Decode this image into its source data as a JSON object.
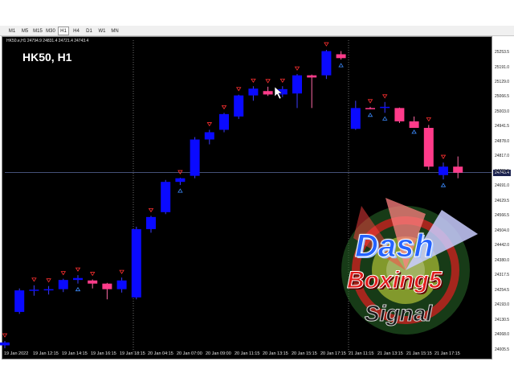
{
  "timeframes": [
    "M1",
    "M5",
    "M15",
    "M30",
    "H1",
    "H4",
    "D1",
    "W1",
    "MN"
  ],
  "active_timeframe": "H1",
  "chart": {
    "symbol_line": "HK50.e,H1  24794.9 24831.4 24721.4 24743.4",
    "title": "HK50, H1",
    "current_price_tag": "24743.4",
    "colors": {
      "bull": "#0a0aff",
      "bear": "#ff3b8a",
      "background": "#000000",
      "signal_up": "#20c020",
      "signal_down": "#ff3030",
      "wick": "#ffffff"
    }
  },
  "logo": {
    "line1": "Dash",
    "line2": "Boxing5",
    "line3": "Signal"
  },
  "chart_data": {
    "type": "candlestick",
    "y_ticks": [
      "25253.5",
      "25191.0",
      "25129.0",
      "25066.5",
      "25003.0",
      "24941.5",
      "24878.0",
      "24817.0",
      "24755.5",
      "24691.0",
      "24629.5",
      "24566.5",
      "24504.0",
      "24442.0",
      "24380.0",
      "24317.5",
      "24254.5",
      "24193.0",
      "24130.5",
      "24068.0",
      "24005.5"
    ],
    "ylim": [
      23995,
      25290
    ],
    "x_ticks": [
      "19 Jan 2022",
      "19 Jan 12:15",
      "19 Jan 14:15",
      "19 Jan 16:15",
      "19 Jan 18:15",
      "20 Jan 04:15",
      "20 Jan 07:00",
      "20 Jan 09:00",
      "20 Jan 11:15",
      "20 Jan 13:15",
      "20 Jan 15:15",
      "20 Jan 17:15",
      "21 Jan 11:15",
      "21 Jan 13:15",
      "21 Jan 15:15",
      "21 Jan 17:15"
    ],
    "candles": [
      {
        "o": 24030,
        "h": 24048,
        "l": 24018,
        "c": 24042
      },
      {
        "o": 24168,
        "h": 24265,
        "l": 24160,
        "c": 24257
      },
      {
        "o": 24257,
        "h": 24278,
        "l": 24235,
        "c": 24260
      },
      {
        "o": 24257,
        "h": 24275,
        "l": 24240,
        "c": 24262
      },
      {
        "o": 24262,
        "h": 24305,
        "l": 24250,
        "c": 24300
      },
      {
        "o": 24300,
        "h": 24320,
        "l": 24285,
        "c": 24308
      },
      {
        "o": 24298,
        "h": 24302,
        "l": 24265,
        "c": 24285
      },
      {
        "o": 24285,
        "h": 24288,
        "l": 24220,
        "c": 24262
      },
      {
        "o": 24262,
        "h": 24310,
        "l": 24248,
        "c": 24298
      },
      {
        "o": 24228,
        "h": 24520,
        "l": 24220,
        "c": 24510
      },
      {
        "o": 24510,
        "h": 24565,
        "l": 24495,
        "c": 24560
      },
      {
        "o": 24580,
        "h": 24713,
        "l": 24572,
        "c": 24705
      },
      {
        "o": 24705,
        "h": 24722,
        "l": 24692,
        "c": 24720
      },
      {
        "o": 24730,
        "h": 24890,
        "l": 24720,
        "c": 24880
      },
      {
        "o": 24880,
        "h": 24920,
        "l": 24860,
        "c": 24910
      },
      {
        "o": 24920,
        "h": 24990,
        "l": 24910,
        "c": 24985
      },
      {
        "o": 24975,
        "h": 25065,
        "l": 24965,
        "c": 25062
      },
      {
        "o": 25062,
        "h": 25100,
        "l": 25040,
        "c": 25090
      },
      {
        "o": 25080,
        "h": 25098,
        "l": 25060,
        "c": 25066
      },
      {
        "o": 25066,
        "h": 25100,
        "l": 25055,
        "c": 25088
      },
      {
        "o": 25070,
        "h": 25150,
        "l": 25010,
        "c": 25145
      },
      {
        "o": 25145,
        "h": 25148,
        "l": 25010,
        "c": 25136
      },
      {
        "o": 25145,
        "h": 25250,
        "l": 25130,
        "c": 25245
      },
      {
        "o": 25232,
        "h": 25245,
        "l": 25210,
        "c": 25216
      },
      {
        "o": 24924,
        "h": 25040,
        "l": 24920,
        "c": 25010
      },
      {
        "o": 25010,
        "h": 25015,
        "l": 25005,
        "c": 25008
      },
      {
        "o": 25012,
        "h": 25035,
        "l": 24990,
        "c": 25015
      },
      {
        "o": 25010,
        "h": 25012,
        "l": 24948,
        "c": 24955
      },
      {
        "o": 24955,
        "h": 24975,
        "l": 24935,
        "c": 24928
      },
      {
        "o": 24928,
        "h": 24940,
        "l": 24755,
        "c": 24768
      },
      {
        "o": 24733,
        "h": 24785,
        "l": 24715,
        "c": 24768
      },
      {
        "o": 24768,
        "h": 24810,
        "l": 24720,
        "c": 24743
      }
    ],
    "signals_down": [
      0,
      2,
      3,
      4,
      5,
      6,
      8,
      10,
      12,
      14,
      15,
      16,
      17,
      18,
      19,
      20,
      22,
      25,
      26,
      29,
      30
    ],
    "signals_up": [
      5,
      12,
      23,
      25,
      26,
      28,
      30
    ],
    "current_price": 24743.4
  }
}
